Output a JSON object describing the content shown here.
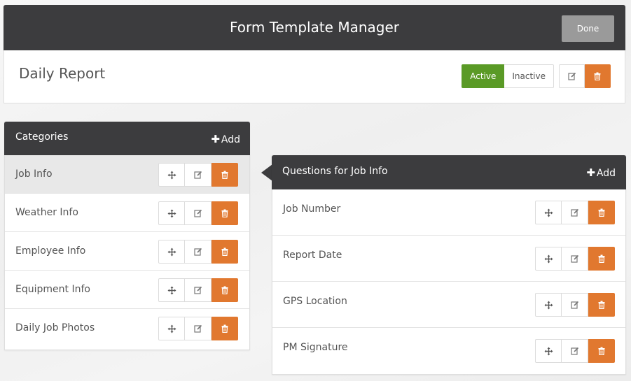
{
  "header": {
    "title": "Form Template Manager",
    "done_label": "Done"
  },
  "template": {
    "name": "Daily Report",
    "status_active_label": "Active",
    "status_inactive_label": "Inactive",
    "selected_status": "Active"
  },
  "categories": {
    "title": "Categories",
    "add_label": "Add",
    "selected": "Job Info",
    "items": [
      {
        "label": "Job Info"
      },
      {
        "label": "Weather Info"
      },
      {
        "label": "Employee Info"
      },
      {
        "label": "Equipment Info"
      },
      {
        "label": "Daily Job Photos"
      }
    ]
  },
  "questions": {
    "title": "Questions for Job Info",
    "add_label": "Add",
    "items": [
      {
        "label": "Job Number"
      },
      {
        "label": "Report Date"
      },
      {
        "label": "GPS Location"
      },
      {
        "label": "PM Signature"
      }
    ]
  },
  "icons": {
    "move": "move-icon",
    "edit": "edit-icon",
    "delete": "trash-icon",
    "add": "plus-icon"
  },
  "colors": {
    "header_bg": "#3c3c3e",
    "active_green": "#5a9a26",
    "delete_orange": "#e1782f",
    "done_gray": "#9a9a9a",
    "selected_row": "#e8e8e8"
  }
}
